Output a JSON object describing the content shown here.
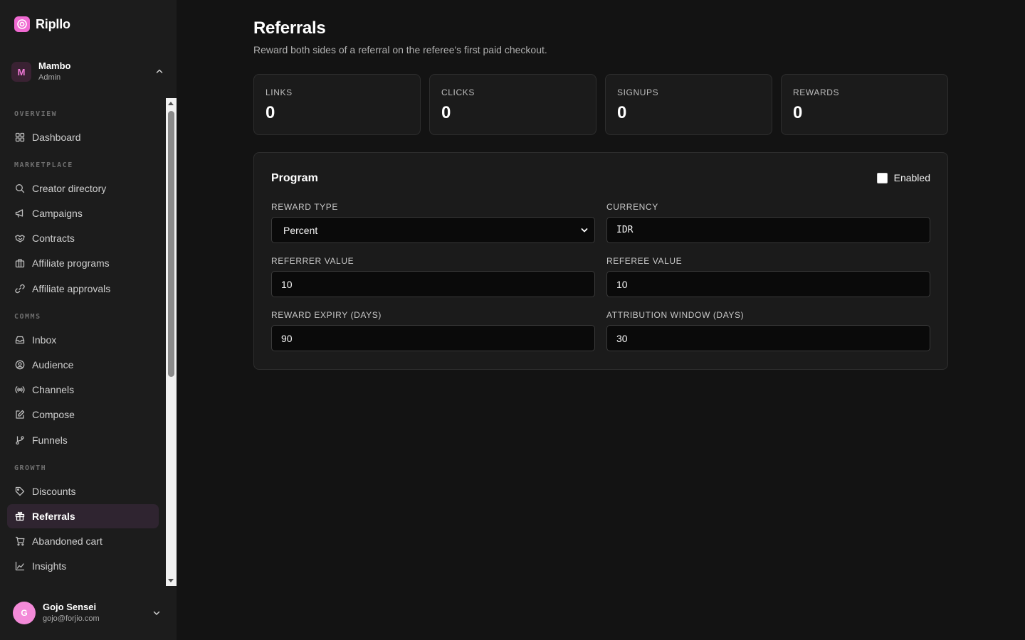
{
  "app": {
    "name": "Ripllo",
    "accent": "#f06ad2"
  },
  "org": {
    "initial": "M",
    "name": "Mambo",
    "role": "Admin"
  },
  "nav": {
    "sections": [
      "OVERVIEW",
      "MARKETPLACE",
      "COMMS",
      "GROWTH"
    ],
    "items": [
      {
        "label": "Dashboard",
        "icon": "dashboard-icon"
      },
      {
        "label": "Creator directory",
        "icon": "search-icon"
      },
      {
        "label": "Campaigns",
        "icon": "megaphone-icon"
      },
      {
        "label": "Contracts",
        "icon": "handshake-icon"
      },
      {
        "label": "Affiliate programs",
        "icon": "briefcase-icon"
      },
      {
        "label": "Affiliate approvals",
        "icon": "link-icon"
      },
      {
        "label": "Inbox",
        "icon": "inbox-icon"
      },
      {
        "label": "Audience",
        "icon": "user-circle-icon"
      },
      {
        "label": "Channels",
        "icon": "broadcast-icon"
      },
      {
        "label": "Compose",
        "icon": "edit-icon"
      },
      {
        "label": "Funnels",
        "icon": "git-branch-icon"
      },
      {
        "label": "Discounts",
        "icon": "tag-icon"
      },
      {
        "label": "Referrals",
        "icon": "gift-icon",
        "active": true
      },
      {
        "label": "Abandoned cart",
        "icon": "cart-icon"
      },
      {
        "label": "Insights",
        "icon": "line-chart-icon"
      }
    ]
  },
  "user": {
    "initial": "G",
    "name": "Gojo Sensei",
    "email": "gojo@forjio.com"
  },
  "page": {
    "title": "Referrals",
    "subtitle": "Reward both sides of a referral on the referee's first paid checkout."
  },
  "stats": [
    {
      "label": "LINKS",
      "value": "0"
    },
    {
      "label": "CLICKS",
      "value": "0"
    },
    {
      "label": "SIGNUPS",
      "value": "0"
    },
    {
      "label": "REWARDS",
      "value": "0"
    }
  ],
  "program": {
    "title": "Program",
    "enabled_label": "Enabled",
    "enabled": false,
    "fields": {
      "reward_type": {
        "label": "REWARD TYPE",
        "value": "Percent"
      },
      "currency": {
        "label": "CURRENCY",
        "value": "IDR"
      },
      "referrer_value": {
        "label": "REFERRER VALUE",
        "value": "10"
      },
      "referee_value": {
        "label": "REFEREE VALUE",
        "value": "10"
      },
      "reward_expiry": {
        "label": "REWARD EXPIRY (DAYS)",
        "value": "90"
      },
      "attribution_window": {
        "label": "ATTRIBUTION WINDOW (DAYS)",
        "value": "30"
      }
    }
  }
}
